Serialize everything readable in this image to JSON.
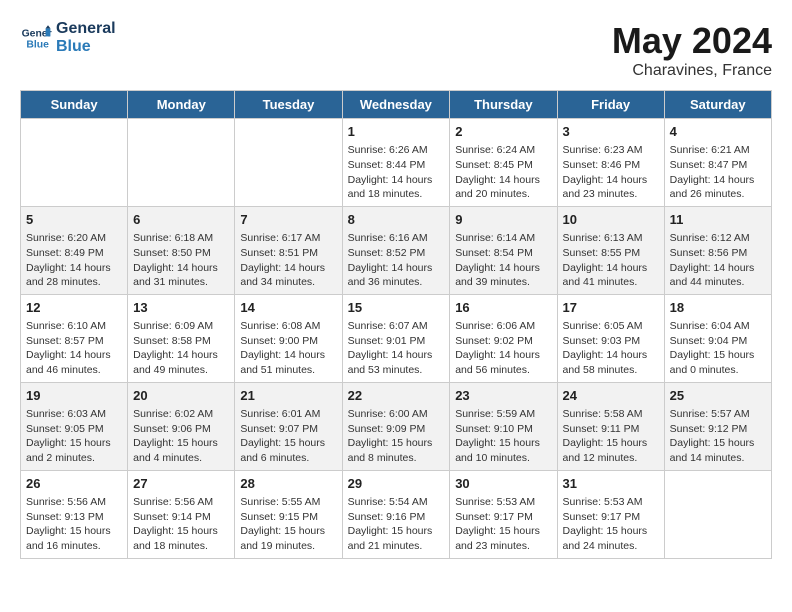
{
  "header": {
    "logo_line1": "General",
    "logo_line2": "Blue",
    "main_title": "May 2024",
    "sub_title": "Charavines, France"
  },
  "days_of_week": [
    "Sunday",
    "Monday",
    "Tuesday",
    "Wednesday",
    "Thursday",
    "Friday",
    "Saturday"
  ],
  "weeks": [
    [
      {
        "day": "",
        "sunrise": "",
        "sunset": "",
        "daylight": ""
      },
      {
        "day": "",
        "sunrise": "",
        "sunset": "",
        "daylight": ""
      },
      {
        "day": "",
        "sunrise": "",
        "sunset": "",
        "daylight": ""
      },
      {
        "day": "1",
        "sunrise": "Sunrise: 6:26 AM",
        "sunset": "Sunset: 8:44 PM",
        "daylight": "Daylight: 14 hours and 18 minutes."
      },
      {
        "day": "2",
        "sunrise": "Sunrise: 6:24 AM",
        "sunset": "Sunset: 8:45 PM",
        "daylight": "Daylight: 14 hours and 20 minutes."
      },
      {
        "day": "3",
        "sunrise": "Sunrise: 6:23 AM",
        "sunset": "Sunset: 8:46 PM",
        "daylight": "Daylight: 14 hours and 23 minutes."
      },
      {
        "day": "4",
        "sunrise": "Sunrise: 6:21 AM",
        "sunset": "Sunset: 8:47 PM",
        "daylight": "Daylight: 14 hours and 26 minutes."
      }
    ],
    [
      {
        "day": "5",
        "sunrise": "Sunrise: 6:20 AM",
        "sunset": "Sunset: 8:49 PM",
        "daylight": "Daylight: 14 hours and 28 minutes."
      },
      {
        "day": "6",
        "sunrise": "Sunrise: 6:18 AM",
        "sunset": "Sunset: 8:50 PM",
        "daylight": "Daylight: 14 hours and 31 minutes."
      },
      {
        "day": "7",
        "sunrise": "Sunrise: 6:17 AM",
        "sunset": "Sunset: 8:51 PM",
        "daylight": "Daylight: 14 hours and 34 minutes."
      },
      {
        "day": "8",
        "sunrise": "Sunrise: 6:16 AM",
        "sunset": "Sunset: 8:52 PM",
        "daylight": "Daylight: 14 hours and 36 minutes."
      },
      {
        "day": "9",
        "sunrise": "Sunrise: 6:14 AM",
        "sunset": "Sunset: 8:54 PM",
        "daylight": "Daylight: 14 hours and 39 minutes."
      },
      {
        "day": "10",
        "sunrise": "Sunrise: 6:13 AM",
        "sunset": "Sunset: 8:55 PM",
        "daylight": "Daylight: 14 hours and 41 minutes."
      },
      {
        "day": "11",
        "sunrise": "Sunrise: 6:12 AM",
        "sunset": "Sunset: 8:56 PM",
        "daylight": "Daylight: 14 hours and 44 minutes."
      }
    ],
    [
      {
        "day": "12",
        "sunrise": "Sunrise: 6:10 AM",
        "sunset": "Sunset: 8:57 PM",
        "daylight": "Daylight: 14 hours and 46 minutes."
      },
      {
        "day": "13",
        "sunrise": "Sunrise: 6:09 AM",
        "sunset": "Sunset: 8:58 PM",
        "daylight": "Daylight: 14 hours and 49 minutes."
      },
      {
        "day": "14",
        "sunrise": "Sunrise: 6:08 AM",
        "sunset": "Sunset: 9:00 PM",
        "daylight": "Daylight: 14 hours and 51 minutes."
      },
      {
        "day": "15",
        "sunrise": "Sunrise: 6:07 AM",
        "sunset": "Sunset: 9:01 PM",
        "daylight": "Daylight: 14 hours and 53 minutes."
      },
      {
        "day": "16",
        "sunrise": "Sunrise: 6:06 AM",
        "sunset": "Sunset: 9:02 PM",
        "daylight": "Daylight: 14 hours and 56 minutes."
      },
      {
        "day": "17",
        "sunrise": "Sunrise: 6:05 AM",
        "sunset": "Sunset: 9:03 PM",
        "daylight": "Daylight: 14 hours and 58 minutes."
      },
      {
        "day": "18",
        "sunrise": "Sunrise: 6:04 AM",
        "sunset": "Sunset: 9:04 PM",
        "daylight": "Daylight: 15 hours and 0 minutes."
      }
    ],
    [
      {
        "day": "19",
        "sunrise": "Sunrise: 6:03 AM",
        "sunset": "Sunset: 9:05 PM",
        "daylight": "Daylight: 15 hours and 2 minutes."
      },
      {
        "day": "20",
        "sunrise": "Sunrise: 6:02 AM",
        "sunset": "Sunset: 9:06 PM",
        "daylight": "Daylight: 15 hours and 4 minutes."
      },
      {
        "day": "21",
        "sunrise": "Sunrise: 6:01 AM",
        "sunset": "Sunset: 9:07 PM",
        "daylight": "Daylight: 15 hours and 6 minutes."
      },
      {
        "day": "22",
        "sunrise": "Sunrise: 6:00 AM",
        "sunset": "Sunset: 9:09 PM",
        "daylight": "Daylight: 15 hours and 8 minutes."
      },
      {
        "day": "23",
        "sunrise": "Sunrise: 5:59 AM",
        "sunset": "Sunset: 9:10 PM",
        "daylight": "Daylight: 15 hours and 10 minutes."
      },
      {
        "day": "24",
        "sunrise": "Sunrise: 5:58 AM",
        "sunset": "Sunset: 9:11 PM",
        "daylight": "Daylight: 15 hours and 12 minutes."
      },
      {
        "day": "25",
        "sunrise": "Sunrise: 5:57 AM",
        "sunset": "Sunset: 9:12 PM",
        "daylight": "Daylight: 15 hours and 14 minutes."
      }
    ],
    [
      {
        "day": "26",
        "sunrise": "Sunrise: 5:56 AM",
        "sunset": "Sunset: 9:13 PM",
        "daylight": "Daylight: 15 hours and 16 minutes."
      },
      {
        "day": "27",
        "sunrise": "Sunrise: 5:56 AM",
        "sunset": "Sunset: 9:14 PM",
        "daylight": "Daylight: 15 hours and 18 minutes."
      },
      {
        "day": "28",
        "sunrise": "Sunrise: 5:55 AM",
        "sunset": "Sunset: 9:15 PM",
        "daylight": "Daylight: 15 hours and 19 minutes."
      },
      {
        "day": "29",
        "sunrise": "Sunrise: 5:54 AM",
        "sunset": "Sunset: 9:16 PM",
        "daylight": "Daylight: 15 hours and 21 minutes."
      },
      {
        "day": "30",
        "sunrise": "Sunrise: 5:53 AM",
        "sunset": "Sunset: 9:17 PM",
        "daylight": "Daylight: 15 hours and 23 minutes."
      },
      {
        "day": "31",
        "sunrise": "Sunrise: 5:53 AM",
        "sunset": "Sunset: 9:17 PM",
        "daylight": "Daylight: 15 hours and 24 minutes."
      },
      {
        "day": "",
        "sunrise": "",
        "sunset": "",
        "daylight": ""
      }
    ]
  ]
}
